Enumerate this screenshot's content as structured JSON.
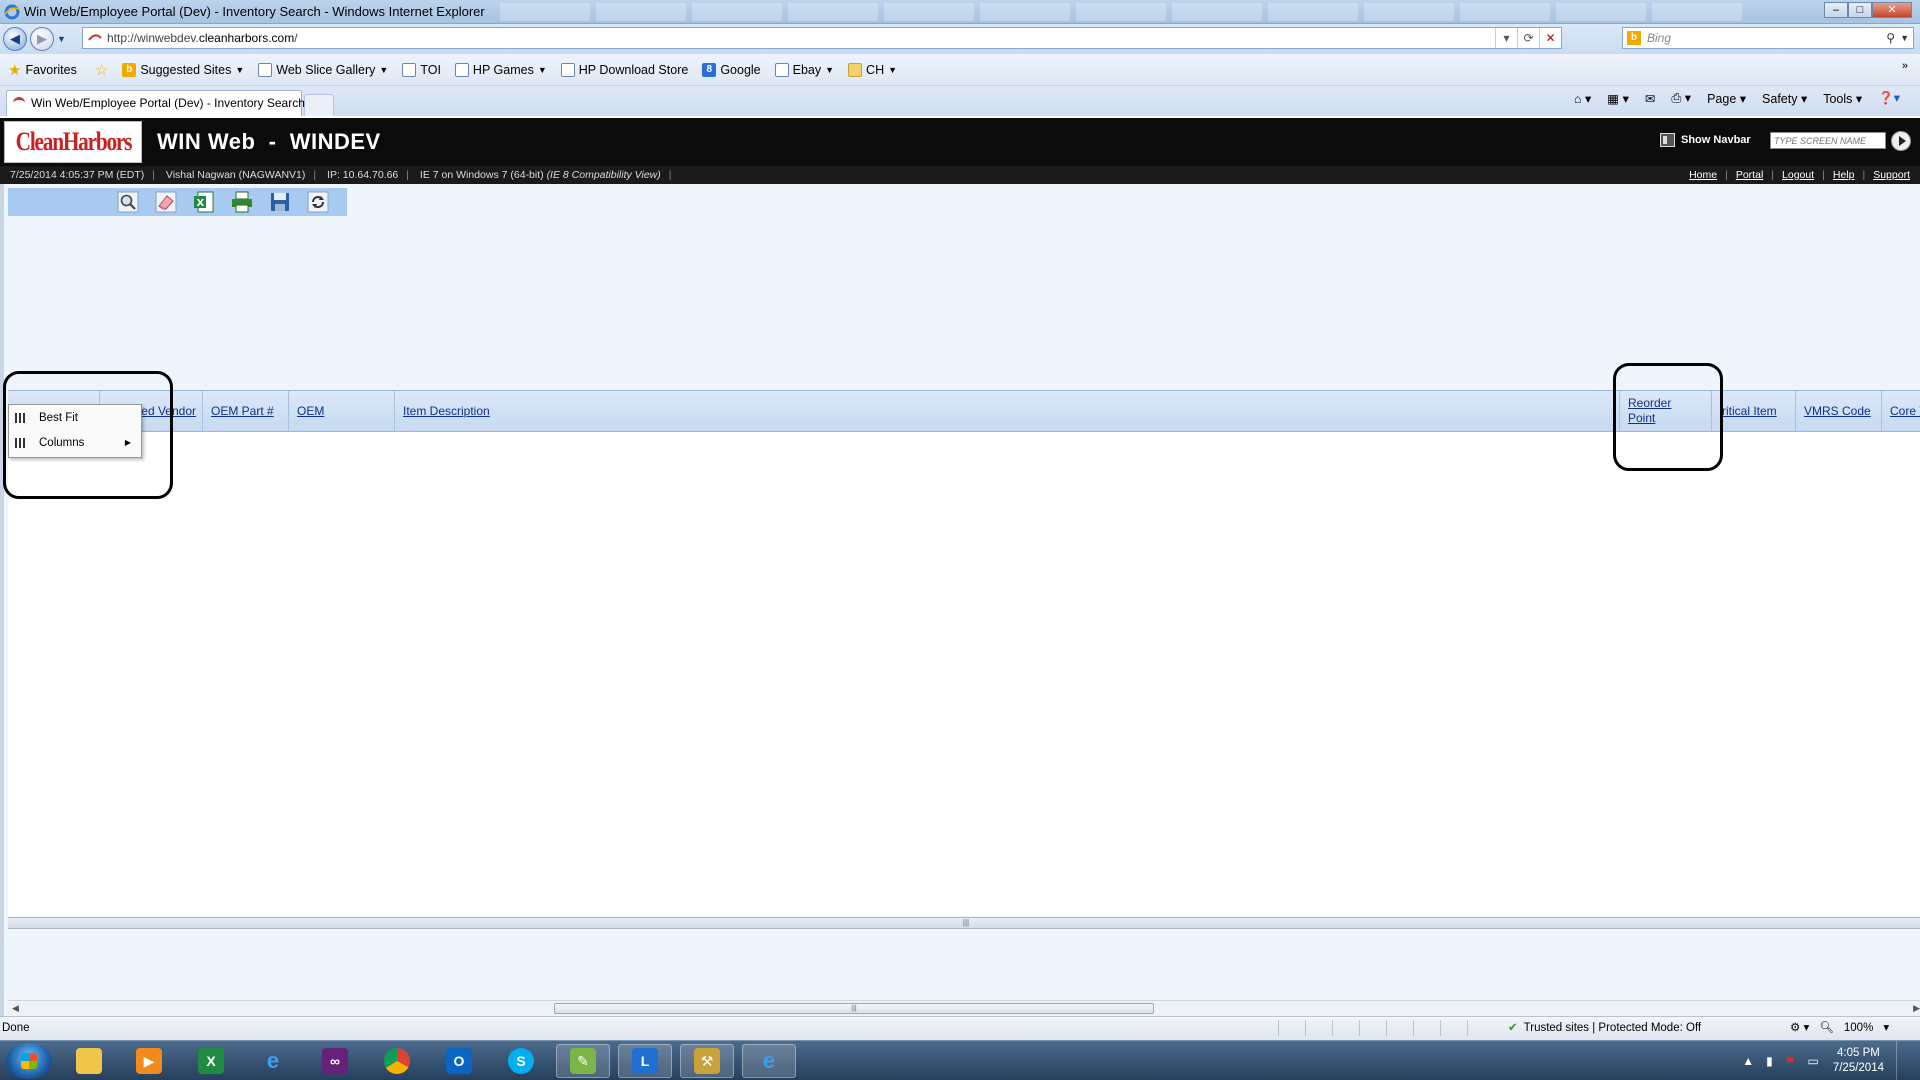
{
  "window": {
    "title": "Win Web/Employee Portal (Dev) - Inventory Search - Windows Internet Explorer",
    "url_prefix": "http://winwebdev.",
    "url_domain": "cleanharbors.com",
    "url_suffix": "/",
    "search_placeholder": "Bing",
    "tab_title": "Win Web/Employee Portal (Dev) - Inventory Search"
  },
  "favorites": {
    "label": "Favorites",
    "items": [
      {
        "label": "Suggested Sites",
        "icon": "bing-icon",
        "dropdown": true
      },
      {
        "label": "Web Slice Gallery",
        "icon": "page-icon",
        "dropdown": true
      },
      {
        "label": "TOI",
        "icon": "page-icon",
        "dropdown": false
      },
      {
        "label": "HP Games",
        "icon": "page-icon",
        "dropdown": true
      },
      {
        "label": "HP Download Store",
        "icon": "page-icon",
        "dropdown": false
      },
      {
        "label": "Google",
        "icon": "google-icon",
        "dropdown": false
      },
      {
        "label": "Ebay",
        "icon": "page-icon",
        "dropdown": true
      },
      {
        "label": "CH",
        "icon": "folder-icon",
        "dropdown": true
      }
    ]
  },
  "commandbar": {
    "page": "Page",
    "safety": "Safety",
    "tools": "Tools"
  },
  "app": {
    "logo_text": "CleanHarbors",
    "title": "WIN Web  -  WINDEV",
    "show_navbar": "Show Navbar",
    "screen_placeholder": "TYPE SCREEN NAME"
  },
  "info": {
    "datetime": "7/25/2014 4:05:37 PM (EDT)",
    "user": "Vishal Nagwan (NAGWANV1)",
    "ip": "IP: 10.64.70.66",
    "browser": "IE 7 on Windows 7 (64-bit)",
    "compat": "(IE 8 Compatibility View)",
    "links": [
      "Home",
      "Portal",
      "Logout",
      "Help",
      "Support"
    ]
  },
  "grid": {
    "columns": {
      "vendor": "ed Vendor",
      "oem_part": "OEM Part #",
      "oem": "OEM",
      "item_description": "Item Description",
      "reorder_point_1": "Reorder",
      "reorder_point_2": "Point",
      "critical_item": "ritical Item",
      "vmrs_code": "VMRS Code",
      "core": "Core V"
    }
  },
  "context_menu": {
    "best_fit": "Best Fit",
    "columns": "Columns"
  },
  "status": {
    "text": "Done",
    "zone": "Trusted sites | Protected Mode: Off",
    "zoom": "100%"
  },
  "taskbar": {
    "time": "4:05 PM",
    "date": "7/25/2014"
  },
  "colors": {
    "brand_red": "#cc1f1f",
    "header_bg": "#0b0b0b",
    "toolbar_bg": "#a9caf0",
    "link_blue": "#102e8c"
  }
}
